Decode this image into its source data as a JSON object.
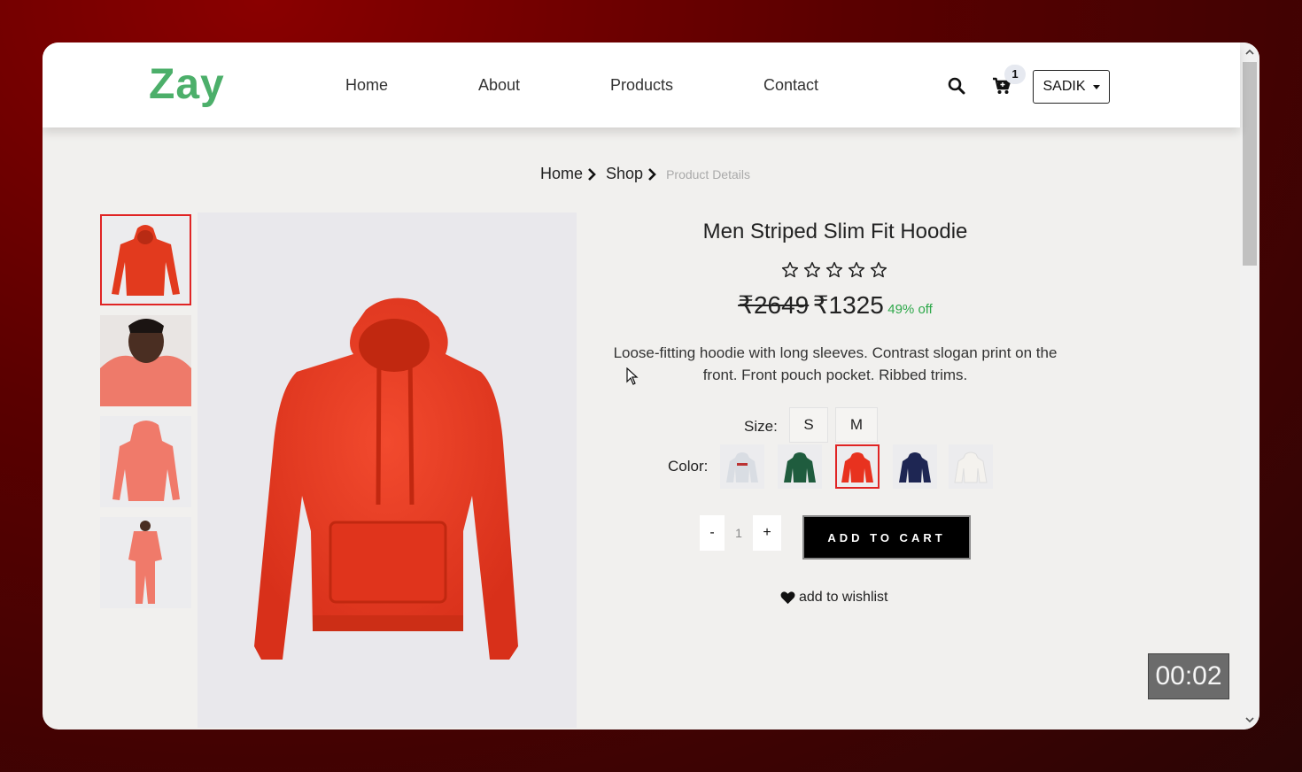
{
  "brand": {
    "logo": "Zay",
    "logo_color": "#4caf6a"
  },
  "nav": {
    "links": [
      "Home",
      "About",
      "Products",
      "Contact"
    ]
  },
  "header": {
    "cart_count": "1",
    "user_label": "SADIK"
  },
  "breadcrumb": {
    "items": [
      "Home",
      "Shop"
    ],
    "current": "Product Details"
  },
  "product": {
    "title": "Men Striped Slim Fit Hoodie",
    "rating": 0,
    "rating_max": 5,
    "old_price": "₹2649",
    "new_price": "₹1325",
    "discount": "49% off",
    "description": "Loose-fitting hoodie with long sleeves. Contrast slogan print on the front. Front pouch pocket. Ribbed trims.",
    "size_label": "Size:",
    "sizes": [
      "S",
      "M"
    ],
    "color_label": "Color:",
    "colors": [
      "#d9dde3",
      "#1f5c3e",
      "#e8321f",
      "#1e2653",
      "#f4f2ee"
    ],
    "selected_color_index": 2,
    "quantity": "1",
    "add_to_cart": "ADD TO CART",
    "wishlist": "add to wishlist"
  },
  "gallery": {
    "thumbnails": [
      "hoodie-front",
      "model-hoodie",
      "hoodie-back",
      "model-full"
    ],
    "active_index": 0
  },
  "overlay": {
    "timer": "00:02"
  },
  "theme": {
    "accent_red": "#e02424",
    "discount_green": "#2ea84a"
  }
}
